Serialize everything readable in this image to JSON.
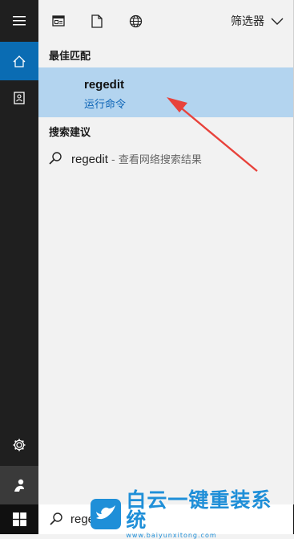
{
  "window": {
    "title": "Windows 10 Search"
  },
  "colors": {
    "accent": "#0a6cb3",
    "selection": "#b3d4ef",
    "subtitle_blue": "#0b63b6",
    "sidebar": "#1f1f1f",
    "taskbar": "#101010",
    "arrow": "#e8423b"
  },
  "sidebar": {
    "items": [
      {
        "icon": "hamburger-menu-icon"
      },
      {
        "icon": "home-icon",
        "active": true
      },
      {
        "icon": "contact-book-icon"
      },
      {
        "icon": "gear-icon"
      },
      {
        "icon": "user-icon"
      }
    ]
  },
  "topbar": {
    "icons": [
      "apps-icon",
      "document-icon",
      "globe-icon"
    ],
    "filter_label": "筛选器"
  },
  "best_match": {
    "section_title": "最佳匹配",
    "name": "regedit",
    "subtitle": "运行命令"
  },
  "suggestions": {
    "section_title": "搜索建议",
    "items": [
      {
        "query": "regedit",
        "desc": " - 查看网络搜索结果"
      }
    ]
  },
  "taskbar": {
    "search_value": "regedit"
  },
  "watermark": {
    "text": "白云一键重装系统",
    "url": "www.baiyunxitong.com"
  }
}
